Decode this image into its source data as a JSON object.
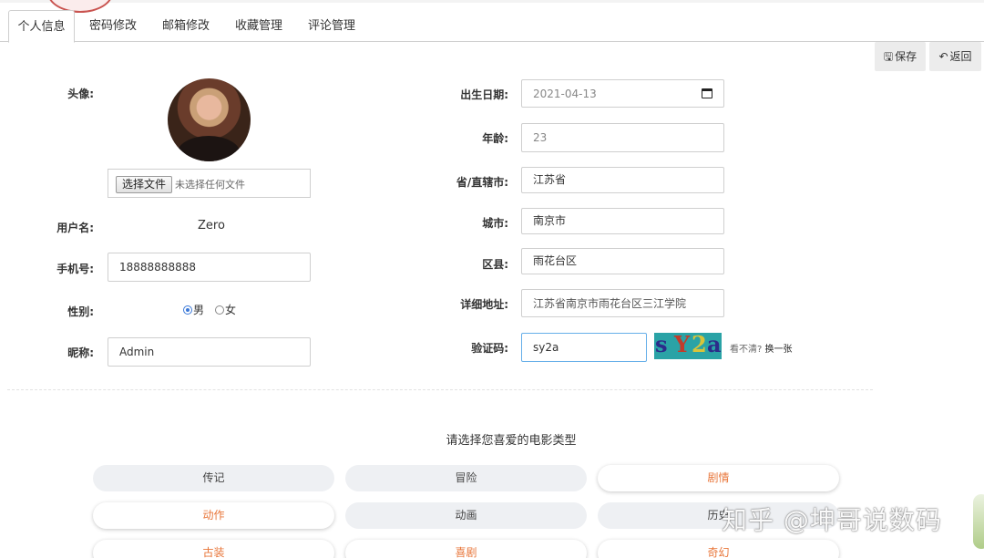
{
  "tabs": [
    {
      "label": "个人信息",
      "active": true
    },
    {
      "label": "密码修改",
      "active": false
    },
    {
      "label": "邮箱修改",
      "active": false
    },
    {
      "label": "收藏管理",
      "active": false
    },
    {
      "label": "评论管理",
      "active": false
    }
  ],
  "actions": {
    "save_label": "保存",
    "save_icon": "floppy-icon",
    "back_label": "返回",
    "back_icon": "undo-arrow-icon"
  },
  "left_form": {
    "avatar_label": "头像:",
    "file_button": "选择文件",
    "file_status": "未选择任何文件",
    "username_label": "用户名:",
    "username_value": "Zero",
    "phone_label": "手机号:",
    "phone_value": "18888888888",
    "gender_label": "性别:",
    "gender_options": [
      "男",
      "女"
    ],
    "gender_selected": "男",
    "nickname_label": "昵称:",
    "nickname_value": "Admin"
  },
  "right_form": {
    "birthday_label": "出生日期:",
    "birthday_value": "2021-04-13",
    "age_label": "年龄:",
    "age_value": "23",
    "province_label": "省/直辖市:",
    "province_value": "江苏省",
    "city_label": "城市:",
    "city_value": "南京市",
    "district_label": "区县:",
    "district_value": "雨花台区",
    "address_label": "详细地址:",
    "address_value": "江苏省南京市雨花台区三江学院",
    "captcha_label": "验证码:",
    "captcha_value": "sy2a",
    "captcha_chars": [
      "s",
      "Y",
      "2",
      "a"
    ],
    "captcha_hint": "看不清?",
    "captcha_refresh": "换一张"
  },
  "genres": {
    "title": "请选择您喜爱的电影类型",
    "items": [
      {
        "label": "传记",
        "selected": false
      },
      {
        "label": "冒险",
        "selected": false
      },
      {
        "label": "剧情",
        "selected": true
      },
      {
        "label": "动作",
        "selected": true
      },
      {
        "label": "动画",
        "selected": false
      },
      {
        "label": "历史",
        "selected": false
      },
      {
        "label": "古装",
        "selected": true
      },
      {
        "label": "喜剧",
        "selected": true
      },
      {
        "label": "奇幻",
        "selected": true
      }
    ]
  },
  "watermark": "知乎 @坤哥说数码",
  "colors": {
    "accent_orange": "#e8763a",
    "focus_blue": "#66afe9",
    "captcha_bg": "#2aa3a6"
  }
}
